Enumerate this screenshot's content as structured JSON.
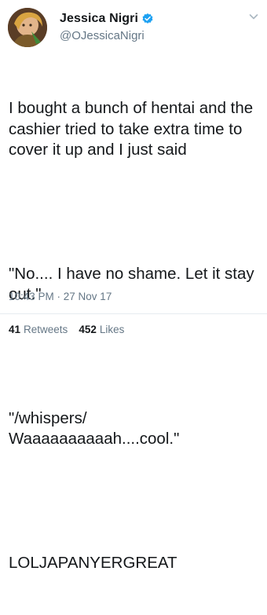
{
  "author": {
    "display_name": "Jessica Nigri",
    "handle": "@OJessicaNigri",
    "verified_icon": "verified-badge-icon"
  },
  "tweet": {
    "paragraphs": [
      "I bought a bunch of hentai and the cashier tried to take extra time to cover it up and I just said",
      "\"No.... I have no shame. Let it stay out.\"",
      "\"/whispers/\nWaaaaaaaaaah....cool.\"",
      "LOLJAPANYERGREAT"
    ],
    "timestamp": "10:43 PM · 27 Nov 17"
  },
  "stats": {
    "retweets_count": "41",
    "retweets_label": "Retweets",
    "likes_count": "452",
    "likes_label": "Likes"
  },
  "colors": {
    "verified_blue": "#1da1f2",
    "secondary_text": "#657786",
    "primary_text": "#14171a",
    "divider": "#e6ecf0"
  }
}
